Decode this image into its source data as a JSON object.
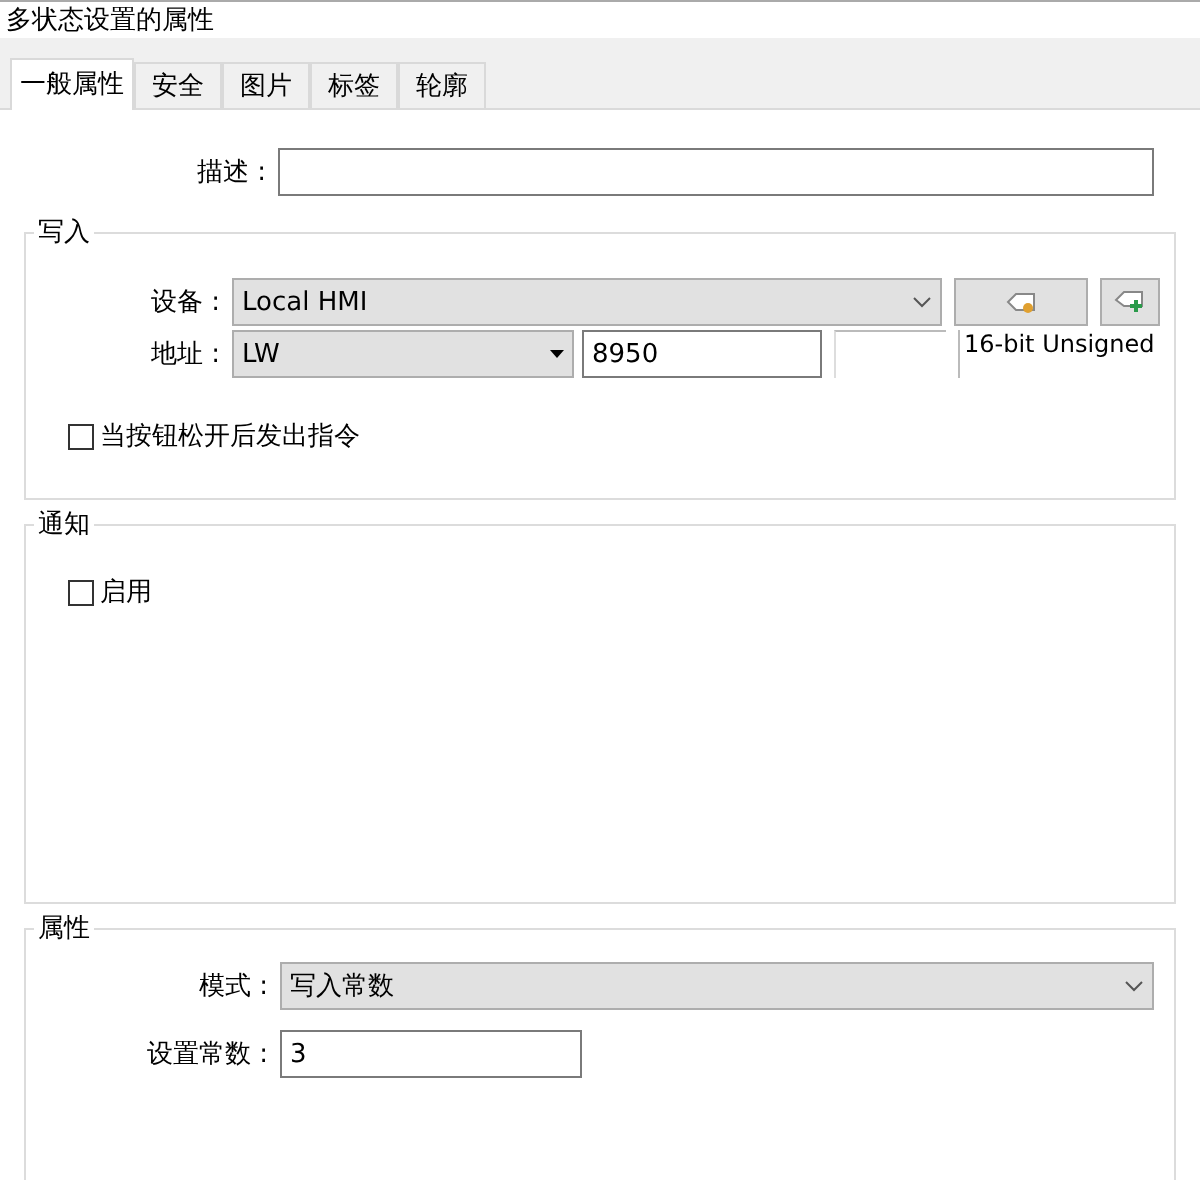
{
  "window": {
    "title": "多状态设置的属性"
  },
  "tabs": [
    {
      "label": "一般属性",
      "selected": true
    },
    {
      "label": "安全",
      "selected": false
    },
    {
      "label": "图片",
      "selected": false
    },
    {
      "label": "标签",
      "selected": false
    },
    {
      "label": "轮廓",
      "selected": false
    }
  ],
  "description": {
    "label": "描述 :"
  },
  "write": {
    "title": "写入",
    "device": {
      "label": "设备 :",
      "value": "Local HMI"
    },
    "address": {
      "label": "地址 :",
      "type": "LW",
      "value": "8950",
      "format": "16-bit Unsigned"
    },
    "release_option": {
      "label": "当按钮松开后发出指令",
      "checked": false
    }
  },
  "notify": {
    "title": "通知",
    "enable": {
      "label": "启用",
      "checked": false
    }
  },
  "properties": {
    "title": "属性",
    "mode": {
      "label": "模式 :",
      "value": "写入常数"
    },
    "constant": {
      "label": "设置常数 :",
      "value": "3"
    }
  }
}
